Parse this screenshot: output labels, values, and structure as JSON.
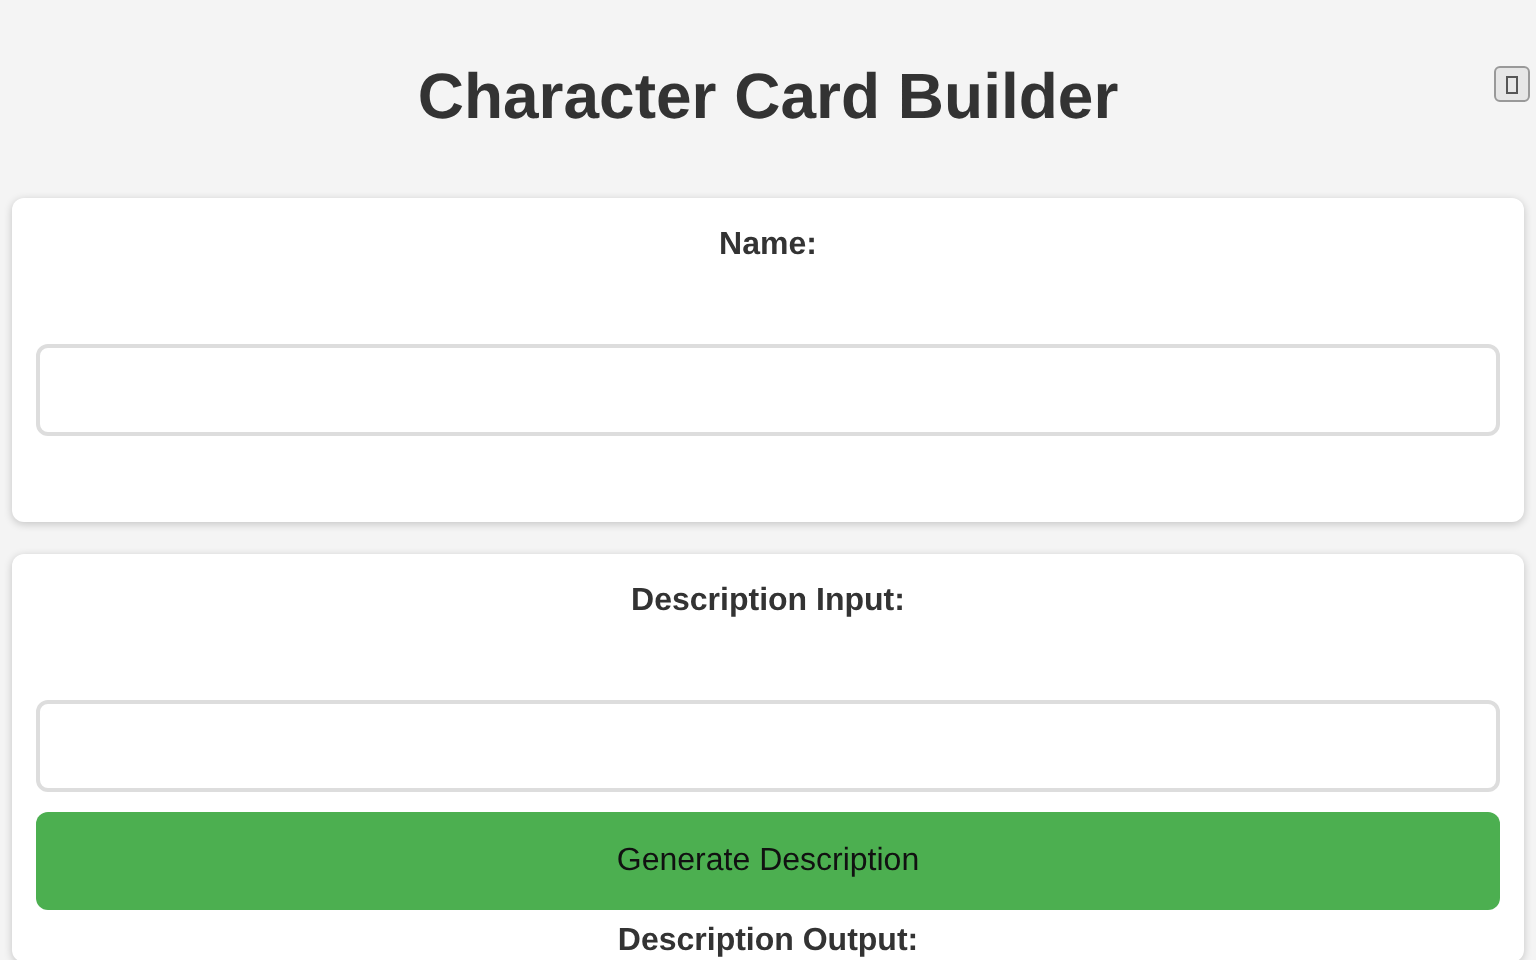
{
  "title": "Character Card Builder",
  "name_section": {
    "label": "Name:"
  },
  "description_section": {
    "label": "Description Input:",
    "button": "Generate Description",
    "output_label": "Description Output:"
  }
}
